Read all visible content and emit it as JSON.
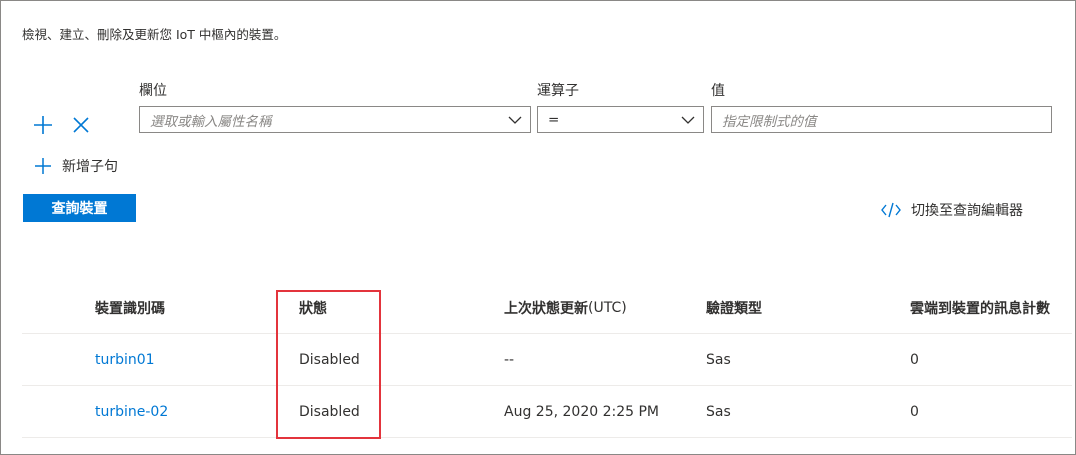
{
  "description": "檢視、建立、刪除及更新您 IoT 中樞內的裝置。",
  "filter": {
    "field_label": "欄位",
    "operator_label": "運算子",
    "value_label": "值",
    "field_placeholder": "選取或輸入屬性名稱",
    "operator_value": "=",
    "value_placeholder": "指定限制式的值",
    "add_icon": "plus-icon",
    "remove_icon": "close-icon"
  },
  "add_clause_label": "新增子句",
  "query_button_label": "查詢裝置",
  "switch_editor_label": "切換至查詢編輯器",
  "table": {
    "headers": {
      "device_id": "裝置識別碼",
      "status": "狀態",
      "last_update_main": "上次狀態更新",
      "last_update_suffix": " (UTC)",
      "auth_type": "驗證類型",
      "c2d_count": "雲端到裝置的訊息計數"
    },
    "rows": [
      {
        "device_id": "turbin01",
        "status": "Disabled",
        "last_update": "--",
        "auth_type": "Sas",
        "c2d_count": "0"
      },
      {
        "device_id": "turbine-02",
        "status": "Disabled",
        "last_update": "Aug 25, 2020 2:25 PM",
        "auth_type": "Sas",
        "c2d_count": "0"
      }
    ]
  },
  "colors": {
    "accent": "#0078d4",
    "highlight": "#e3343c"
  }
}
